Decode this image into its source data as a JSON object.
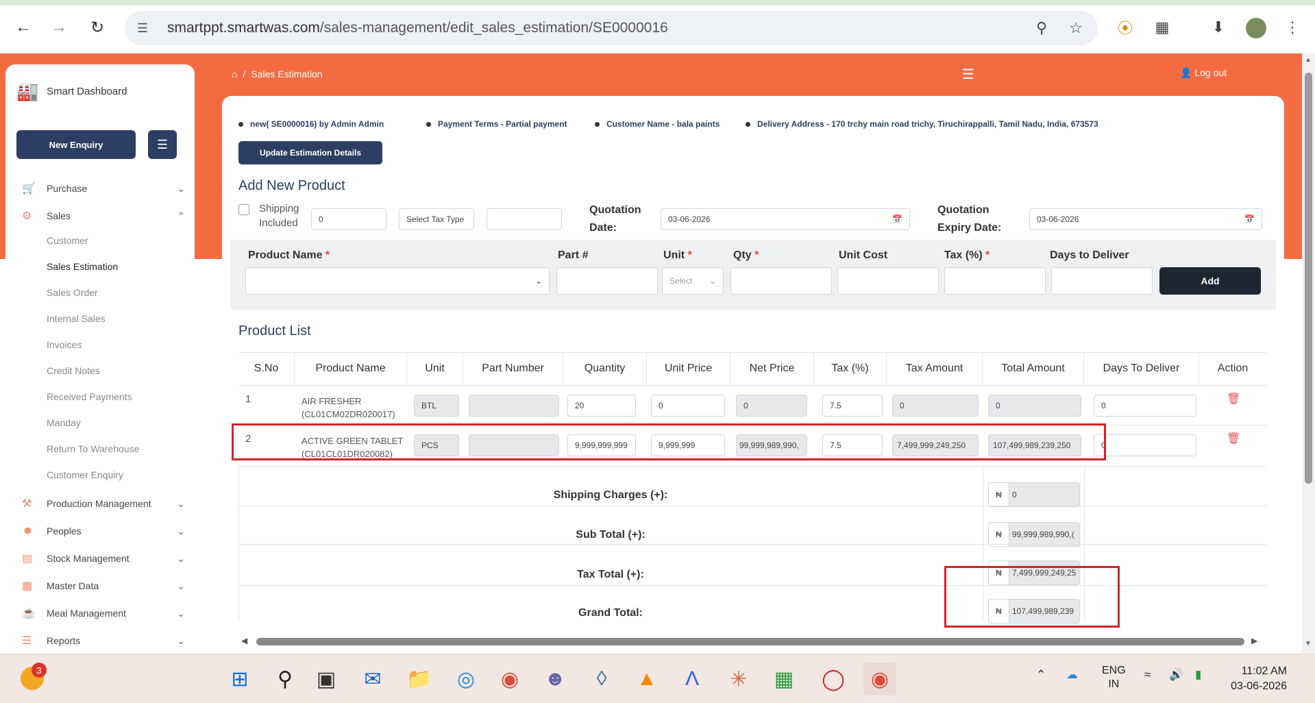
{
  "browser": {
    "url_domain": "smartppt.smartwas.com",
    "url_path": "/sales-management/edit_sales_estimation/SE0000016"
  },
  "sidebar": {
    "brand": "Smart Dashboard",
    "new_enquiry": "New Enquiry",
    "items": [
      {
        "label": "Purchase"
      },
      {
        "label": "Sales"
      },
      {
        "label": "Production Management"
      },
      {
        "label": "Peoples"
      },
      {
        "label": "Stock Management"
      },
      {
        "label": "Master Data"
      },
      {
        "label": "Meal Management"
      },
      {
        "label": "Reports"
      }
    ],
    "sales_sub": [
      "Customer",
      "Sales Estimation",
      "Sales Order",
      "Internal Sales",
      "Invoices",
      "Credit Notes",
      "Received Payments",
      "Manday",
      "Return To Warehouse",
      "Customer Enquiry"
    ]
  },
  "header": {
    "breadcrumb_sep": "/",
    "breadcrumb": "Sales Estimation",
    "logout": "Log out"
  },
  "meta": {
    "estimation": "new( SE0000016) by Admin Admin",
    "payment_terms": "Payment Terms - Partial payment",
    "customer": "Customer Name - bala paints",
    "delivery": "Delivery Address - 170 trchy main road trichy, Tiruchirappalli, Tamil Nadu, India, 673573"
  },
  "update_btn": "Update Estimation Details",
  "add_product": {
    "title": "Add New Product",
    "shipping_label_1": "Shipping",
    "shipping_label_2": "Included",
    "shipping_value": "0",
    "tax_type": "Select Tax Type",
    "quotation_date_label_1": "Quotation",
    "quotation_date_label_2": "Date:",
    "quotation_date": "03-06-2026",
    "expiry_label_1": "Quotation",
    "expiry_label_2": "Expiry Date:",
    "expiry_date": "03-06-2026",
    "fields": {
      "product_name": "Product Name",
      "part": "Part #",
      "unit": "Unit",
      "qty": "Qty",
      "unit_cost": "Unit Cost",
      "tax": "Tax (%)",
      "days": "Days to Deliver"
    },
    "required": "*",
    "unit_placeholder": "Select",
    "add_btn": "Add"
  },
  "product_list": {
    "title": "Product List",
    "columns": [
      "S.No",
      "Product Name",
      "Unit",
      "Part Number",
      "Quantity",
      "Unit Price",
      "Net Price",
      "Tax (%)",
      "Tax Amount",
      "Total Amount",
      "Days To Deliver",
      "Action"
    ],
    "rows": [
      {
        "sno": "1",
        "name_1": "AIR FRESHER",
        "name_2": "(CL01CM02DR020017)",
        "unit": "BTL",
        "part": "",
        "qty": "20",
        "unit_price": "0",
        "net_price": "0",
        "tax": "7.5",
        "tax_amount": "0",
        "total": "0",
        "days": "0"
      },
      {
        "sno": "2",
        "name_1": "ACTIVE GREEN TABLET",
        "name_2": "(CL01CL01DR020082)",
        "unit": "PCS",
        "part": "",
        "qty": "9,999,999,999",
        "unit_price": "9,999,999",
        "net_price": "99,999,989,990,",
        "tax": "7.5",
        "tax_amount": "7,499,999,249,250",
        "total": "107,499,989,239,250",
        "days": "0"
      }
    ],
    "summary": {
      "currency": "₦",
      "shipping_label": "Shipping Charges (+):",
      "shipping": "0",
      "subtotal_label": "Sub Total (+):",
      "subtotal": "99,999,989,990,(",
      "taxtotal_label": "Tax Total (+):",
      "taxtotal": "7,499,999,249,25",
      "grand_label": "Grand Total:",
      "grand": "107,499,989,239"
    }
  },
  "taskbar": {
    "badge": "3",
    "lang_1": "ENG",
    "lang_2": "IN",
    "time": "11:02 AM",
    "date": "03-06-2026"
  },
  "colors": {
    "accent": "#f46b42",
    "primary": "#2c3e63",
    "highlight": "#d3222a"
  }
}
